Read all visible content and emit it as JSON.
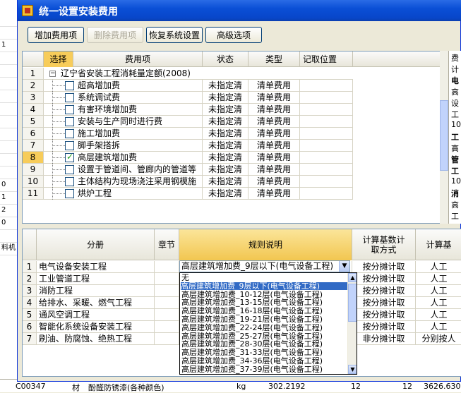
{
  "window": {
    "title": "统一设置安装费用"
  },
  "toolbar": {
    "add": "增加费用项",
    "delete": "删除费用项",
    "restore": "恢复系统设置",
    "advanced": "高级选项"
  },
  "top_grid": {
    "headers": [
      "选择",
      "费用项",
      "状态",
      "类型",
      "记取位置"
    ],
    "rows": [
      {
        "n": "1",
        "name": "辽宁省安装工程消耗量定额(2008)",
        "status": "",
        "type": "",
        "checked": false,
        "group": true
      },
      {
        "n": "2",
        "name": "超高增加费",
        "status": "未指定清",
        "type": "清单费用",
        "checked": false
      },
      {
        "n": "3",
        "name": "系统调试费",
        "status": "未指定清",
        "type": "清单费用",
        "checked": false
      },
      {
        "n": "4",
        "name": "有害环境增加费",
        "status": "未指定清",
        "type": "清单费用",
        "checked": false
      },
      {
        "n": "5",
        "name": "安装与生产同时进行费",
        "status": "未指定清",
        "type": "清单费用",
        "checked": false
      },
      {
        "n": "6",
        "name": "施工增加费",
        "status": "未指定清",
        "type": "清单费用",
        "checked": false
      },
      {
        "n": "7",
        "name": "脚手架搭拆",
        "status": "未指定清",
        "type": "清单费用",
        "checked": false
      },
      {
        "n": "8",
        "name": "高层建筑增加费",
        "status": "未指定清",
        "type": "清单费用",
        "checked": true
      },
      {
        "n": "9",
        "name": "设置于管道间、管廊内的管道等",
        "status": "未指定清",
        "type": "清单费用",
        "checked": false
      },
      {
        "n": "10",
        "name": "主体结构为现场浇注采用钢模施",
        "status": "未指定清",
        "type": "清单费用",
        "checked": false
      },
      {
        "n": "11",
        "name": "烘炉工程",
        "status": "未指定清",
        "type": "清单费用",
        "checked": false
      }
    ]
  },
  "right_panel": [
    "费",
    "计",
    "电",
    "高",
    "设",
    "工",
    "10",
    "工",
    "高",
    "管",
    "工",
    "10",
    "消",
    "高",
    "工"
  ],
  "bottom_grid": {
    "headers": [
      "分册",
      "章节",
      "规则说明",
      "计算基数计取方式",
      "计算基"
    ],
    "rows": [
      {
        "n": "1",
        "name": "电气设备安装工程",
        "rule": "高层建筑增加费_9层以下(电气设备工程)",
        "method": "按分摊计取",
        "base": "人工"
      },
      {
        "n": "2",
        "name": "工业管道工程",
        "rule": "",
        "method": "按分摊计取",
        "base": "人工"
      },
      {
        "n": "3",
        "name": "消防工程",
        "rule": "",
        "method": "按分摊计取",
        "base": "人工"
      },
      {
        "n": "4",
        "name": "给排水、采暖、燃气工程",
        "rule": "",
        "method": "按分摊计取",
        "base": "人工"
      },
      {
        "n": "5",
        "name": "通风空调工程",
        "rule": "",
        "method": "按分摊计取",
        "base": "人工"
      },
      {
        "n": "6",
        "name": "智能化系统设备安装工程",
        "rule": "",
        "method": "按分摊计取",
        "base": "人工"
      },
      {
        "n": "7",
        "name": "刷油、防腐蚀、绝热工程",
        "rule": "",
        "method": "非分摊计取",
        "base": "分别按人"
      }
    ]
  },
  "dropdown": {
    "options": [
      "无",
      "高层建筑增加费_9层以下(电气设备工程)",
      "高层建筑增加费_10-12层(电气设备工程)",
      "高层建筑增加费_13-15层(电气设备工程)",
      "高层建筑增加费_16-18层(电气设备工程)",
      "高层建筑增加费_19-21层(电气设备工程)",
      "高层建筑增加费_22-24层(电气设备工程)",
      "高层建筑增加费_25-27层(电气设备工程)",
      "高层建筑增加费_28-30层(电气设备工程)",
      "高层建筑增加费_31-33层(电气设备工程)",
      "高层建筑增加费_34-36层(电气设备工程)",
      "高层建筑增加费_37-39层(电气设备工程)"
    ],
    "selected_index": 1
  },
  "background": {
    "left_col": [
      "",
      "",
      "1",
      "",
      "",
      "",
      "",
      "",
      "",
      "",
      "",
      "",
      "",
      "0",
      "1",
      "2",
      "0",
      "",
      "料机"
    ],
    "bottom_row": [
      "C00347",
      "材",
      "酚醛防锈漆(各种颜色)",
      "kg",
      "302.2192",
      "12",
      "12",
      "3626.6304"
    ]
  },
  "colors": {
    "title_bar": "#0a4fd6",
    "selected_header": "#f7cc5a",
    "selection": "#316ac5"
  }
}
